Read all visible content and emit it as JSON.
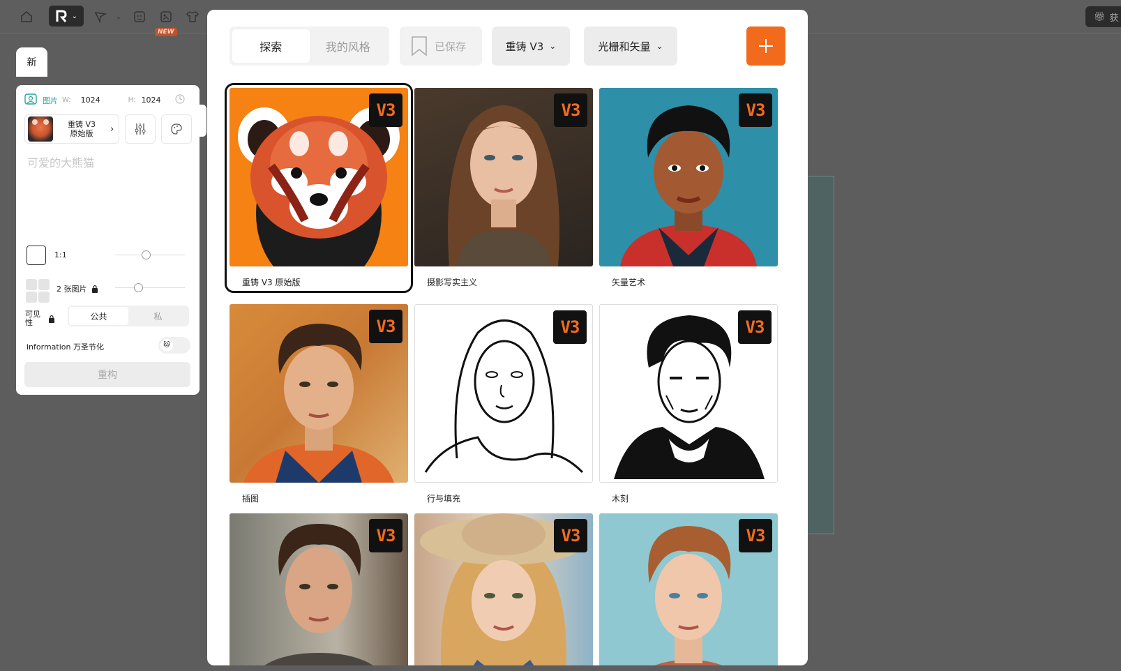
{
  "topbar": {
    "new_badge": "NEW",
    "gift_label": "获"
  },
  "left_panel": {
    "new_tab": "新",
    "image_label": "图片",
    "width_label": "W:",
    "width_value": "1024",
    "height_label": "H:",
    "height_value": "1024",
    "model_name_line1": "重铸 V3",
    "model_name_line2": "原始版",
    "prompt_placeholder": "可爱的大熊猫",
    "aspect_ratio": "1:1",
    "image_count": "2 张图片",
    "visibility_label_line1": "可见",
    "visibility_label_line2": "性",
    "visibility_public": "公共",
    "visibility_private": "私",
    "halloween_label": "information 万圣节化",
    "reforge_button": "重构"
  },
  "modal": {
    "tab_explore": "探索",
    "tab_my_styles": "我的风格",
    "saved_button": "已保存",
    "model_dropdown": "重铸 V3",
    "type_dropdown": "光栅和矢量",
    "badge": "V3",
    "styles": [
      {
        "name": "重铸 V3 原始版",
        "selected": true
      },
      {
        "name": "摄影写实主义",
        "selected": false
      },
      {
        "name": "矢量艺术",
        "selected": false
      },
      {
        "name": "插图",
        "selected": false
      },
      {
        "name": "行与填充",
        "selected": false
      },
      {
        "name": "木刻",
        "selected": false
      },
      {
        "name": "",
        "selected": false
      },
      {
        "name": "",
        "selected": false
      },
      {
        "name": "",
        "selected": false
      }
    ]
  },
  "colors": {
    "accent": "#f26b1d",
    "teal_label": "#27a39b",
    "backdrop": "#5d5d5d"
  }
}
